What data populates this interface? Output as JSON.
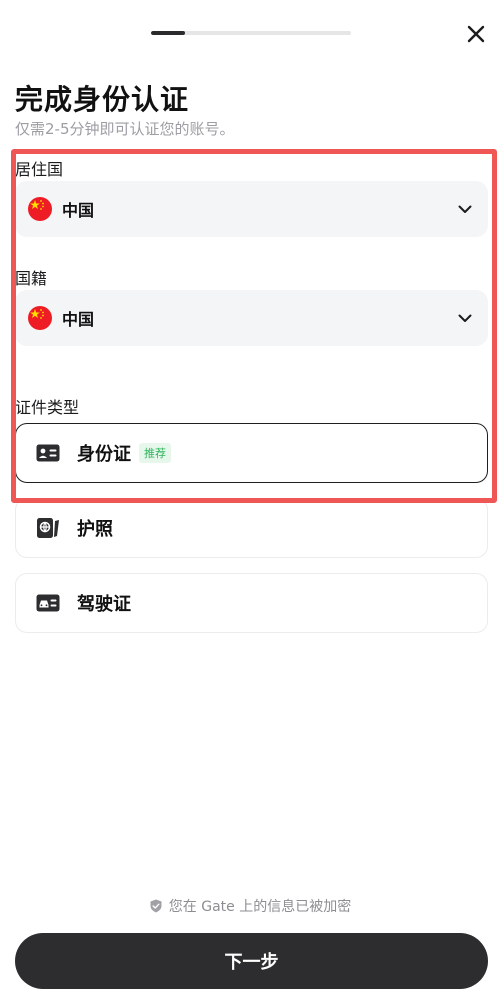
{
  "header": {
    "progress_fraction": 0.17,
    "title": "完成身份认证",
    "subtitle": "仅需2-5分钟即可认证您的账号。"
  },
  "residence": {
    "label": "居住国",
    "value": "中国",
    "flag_icon": "china-flag-icon"
  },
  "nationality": {
    "label": "国籍",
    "value": "中国",
    "flag_icon": "china-flag-icon"
  },
  "document_type": {
    "label": "证件类型",
    "options": [
      {
        "label": "身份证",
        "badge": "推荐",
        "icon": "id-card-icon",
        "selected": true
      },
      {
        "label": "护照",
        "badge": "",
        "icon": "passport-icon",
        "selected": false
      },
      {
        "label": "驾驶证",
        "badge": "",
        "icon": "driver-license-icon",
        "selected": false
      }
    ]
  },
  "footer": {
    "security_note": "您在 Gate 上的信息已被加密",
    "next_button": "下一步"
  },
  "colors": {
    "primary_button": "#2d2d30",
    "highlight_border": "#ef5656",
    "badge_green": "#2fb55d",
    "flag_red": "#ee1c25",
    "flag_yellow": "#ffde00"
  }
}
